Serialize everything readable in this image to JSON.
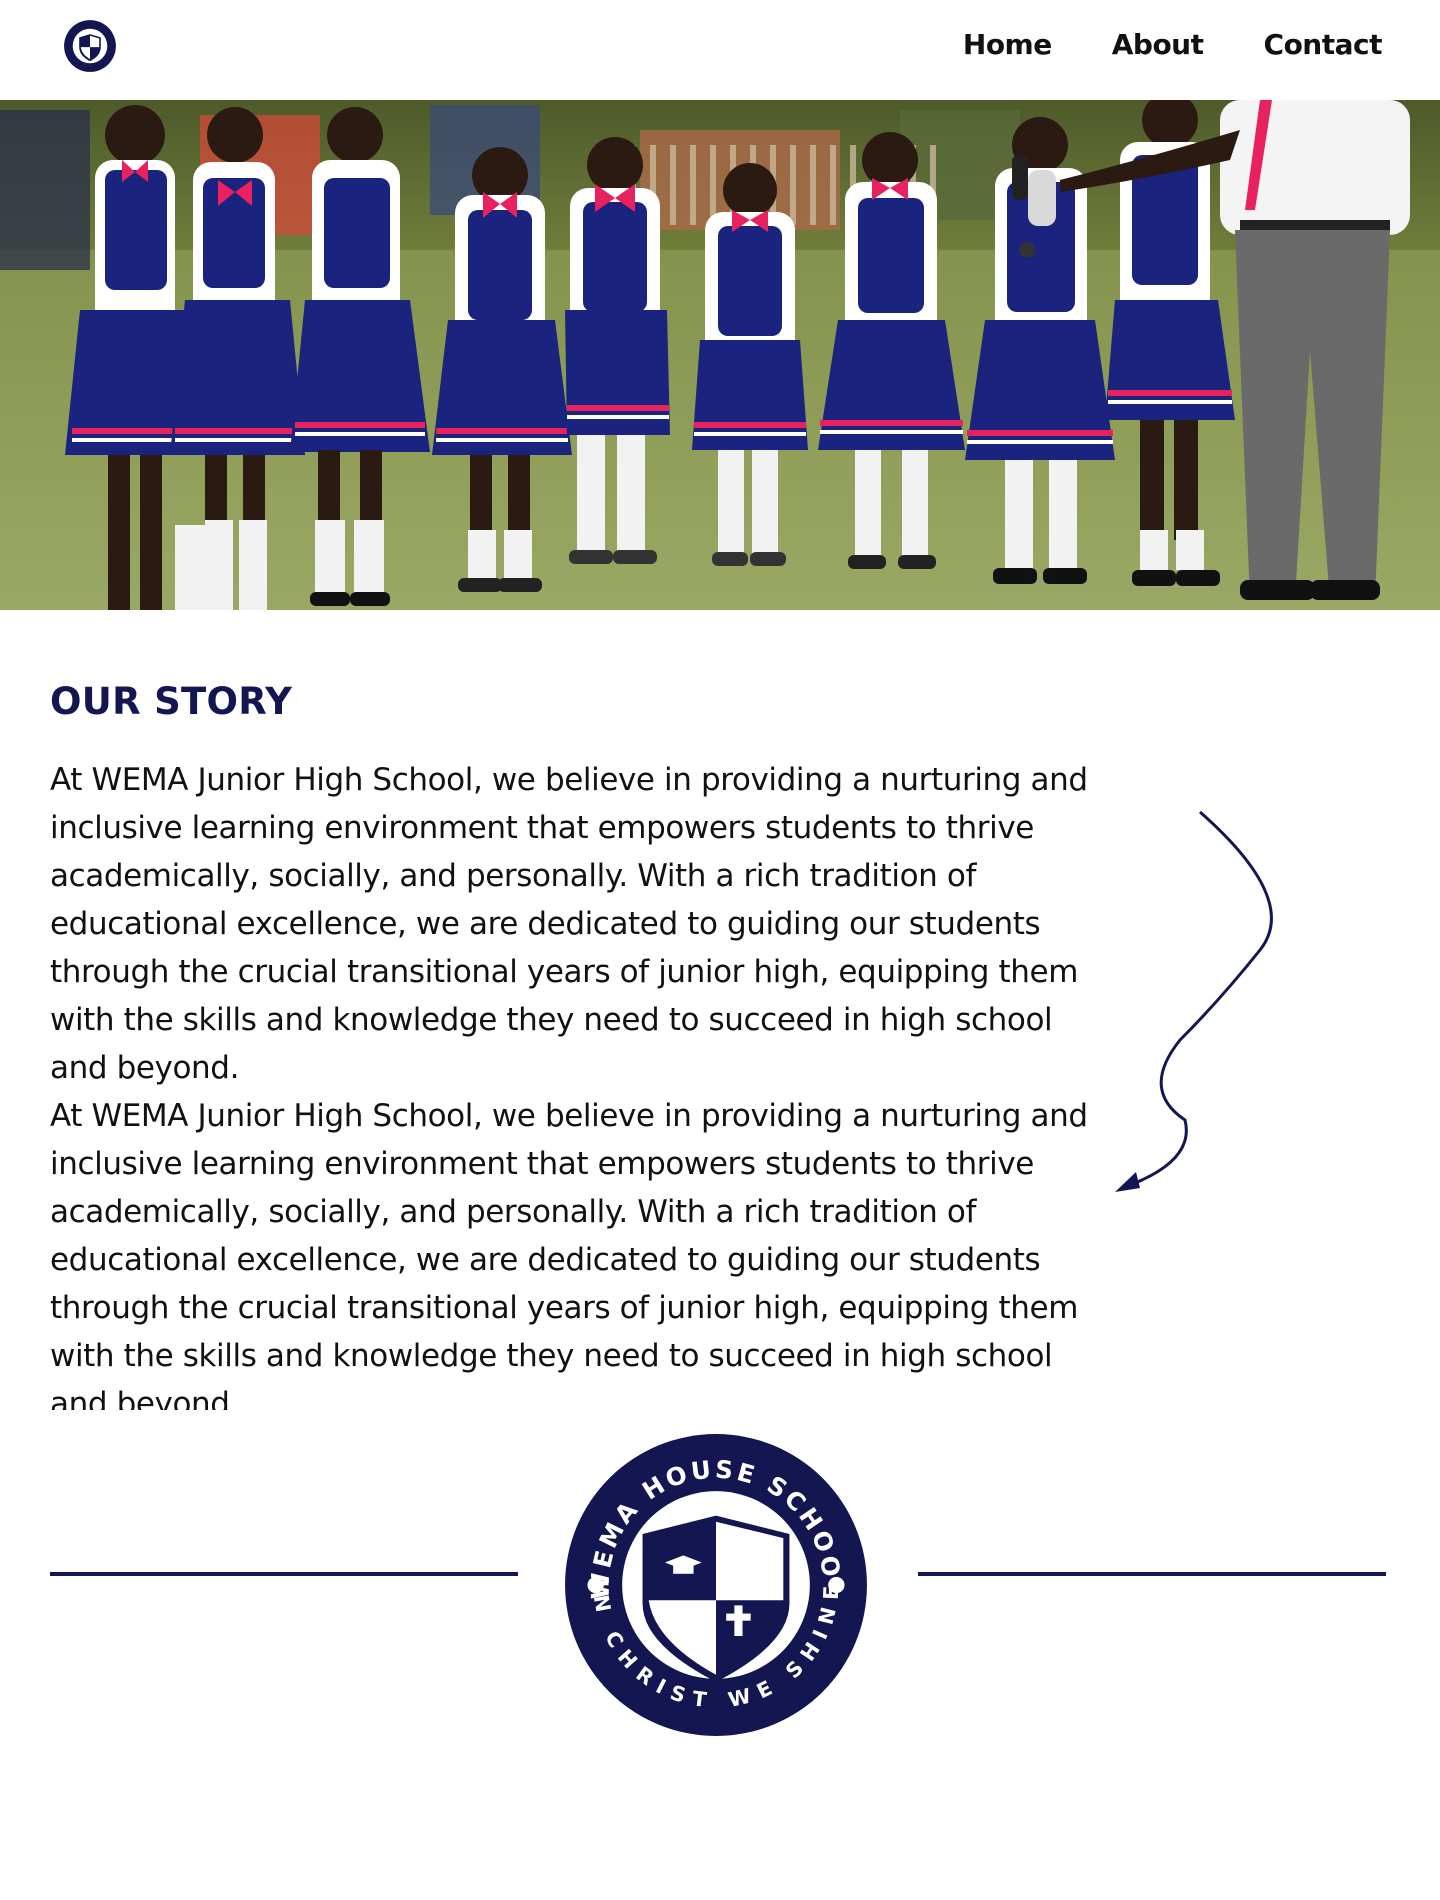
{
  "header": {
    "logo": {
      "name": "school-crest-logo",
      "text": "WEMA HOUSE SCHOOL"
    },
    "nav": [
      "Home",
      "About",
      "Contact"
    ]
  },
  "hero": {
    "image": "school-choir-photo"
  },
  "story": {
    "title": "OUR STORY",
    "paragraphs": [
      "At WEMA Junior High School, we believe in providing a nurturing and inclusive learning environment that empowers students to thrive academically, socially, and personally. With a rich tradition of educational excellence, we are dedicated to guiding our students through the crucial transitional years of junior high, equipping them with the skills and knowledge they need to succeed in high school and beyond.",
      " At WEMA Junior High School, we believe in providing a nurturing and inclusive learning environment that empowers students to thrive academically, socially, and personally. With a rich tradition of educational excellence, we are dedicated to guiding our students through the crucial transitional years of junior high, equipping them with the skills and knowledge they need to succeed in high school and beyond."
    ]
  },
  "emblem": {
    "top_text": "WEMA HOUSE SCHOOL",
    "bottom_text": "IN CHRIST WE SHINE"
  },
  "colors": {
    "navy": "#141652",
    "text": "#111111",
    "accent_pink": "#e8215f",
    "grass": "#8a9a45"
  }
}
